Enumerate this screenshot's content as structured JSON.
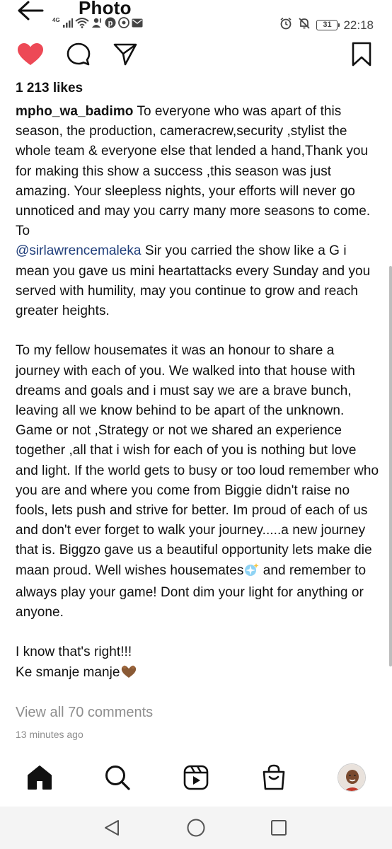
{
  "header": {
    "title": "Photo",
    "network_label": "4G",
    "battery_level": "31",
    "time": "22:18"
  },
  "post": {
    "likes": "1 213 likes",
    "username": "mpho_wa_badimo",
    "caption_part1": " To everyone who was apart of this season, the production, cameracrew,security ,stylist the whole team & everyone else that lended a hand,Thank you for making this show a success ,this season was just amazing. Your sleepless nights, your efforts will never go unnoticed and may you carry many more seasons to come. To\n",
    "mention": "@sirlawrencemaleka",
    "caption_part2": " Sir you carried the show like a G i mean you gave us mini heartattacks every Sunday and you served with humility, may you continue to grow and reach greater heights.\n\nTo my fellow housemates it was an honour to share a journey with each of you. We walked into that house with dreams and goals and i must say we are a brave bunch, leaving all we know behind to be apart of the unknown. Game or not ,Strategy or not we shared an experience  together ,all that i wish for each of you is nothing but love and light. If the world gets to busy or too loud remember who you are and where you come from Biggie didn't raise no fools, lets push and strive for better. Im proud of each of us and don't ever forget to walk your journey.....a new journey that is. Biggzo gave us a beautiful opportunity lets make die maan proud. Well wishes housemates",
    "caption_part3": " and remember to always play your game! Dont dim your light for anything or anyone.\n\nI know that's right!!!\nKe smanje manje",
    "view_comments": "View all 70 comments",
    "timestamp": "13 minutes ago"
  },
  "colors": {
    "heart": "#ed4956",
    "mention": "#1f3d7a",
    "muted": "#8e8e8e"
  },
  "icons": [
    "back-arrow-icon",
    "heart-icon",
    "comment-icon",
    "share-icon",
    "bookmark-icon",
    "home-icon",
    "search-icon",
    "reels-icon",
    "shop-icon",
    "profile-avatar",
    "nav-back-icon",
    "nav-home-icon",
    "nav-recents-icon"
  ]
}
